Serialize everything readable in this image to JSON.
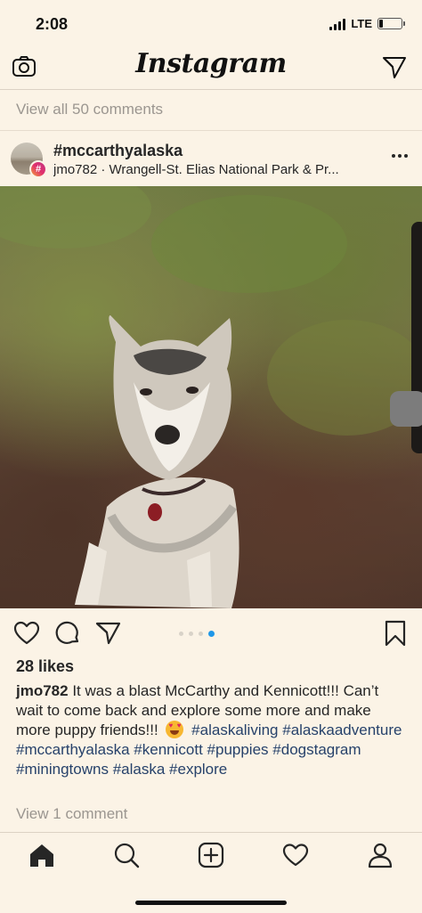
{
  "status_bar": {
    "time": "2:08",
    "network": "LTE"
  },
  "header": {
    "logo": "Instagram"
  },
  "previous_post": {
    "view_all_comments": "View all 50 comments"
  },
  "post": {
    "title": "#mccarthyalaska",
    "subtitle": "jmo782 · Wrangell-St. Elias National Park & Pr...",
    "likes": "28 likes",
    "carousel": {
      "count": 4,
      "active_index": 3
    },
    "caption": {
      "username": "jmo782",
      "text": "It was a blast McCarthy and Kennicott!!! Can’t wait to come back and explore some more and make more puppy friends!!!",
      "emoji": "heart-eyes-emoji",
      "tags": [
        "#alaskaliving",
        "#alaskaadventure",
        "#mccarthyalaska",
        "#kennicott",
        "#puppies",
        "#dogstagram",
        "#miningtowns",
        "#alaska",
        "#explore"
      ]
    },
    "view_comments": "View 1 comment"
  },
  "tabbar": {
    "icons": [
      "home-icon",
      "search-icon",
      "new-post-icon",
      "activity-heart-icon",
      "profile-icon"
    ],
    "active": "home-icon"
  },
  "colors": {
    "background": "#fbf3e6",
    "hashtag": "#27426b",
    "carousel_active": "#1f97e8",
    "muted_text": "#9b9690"
  }
}
